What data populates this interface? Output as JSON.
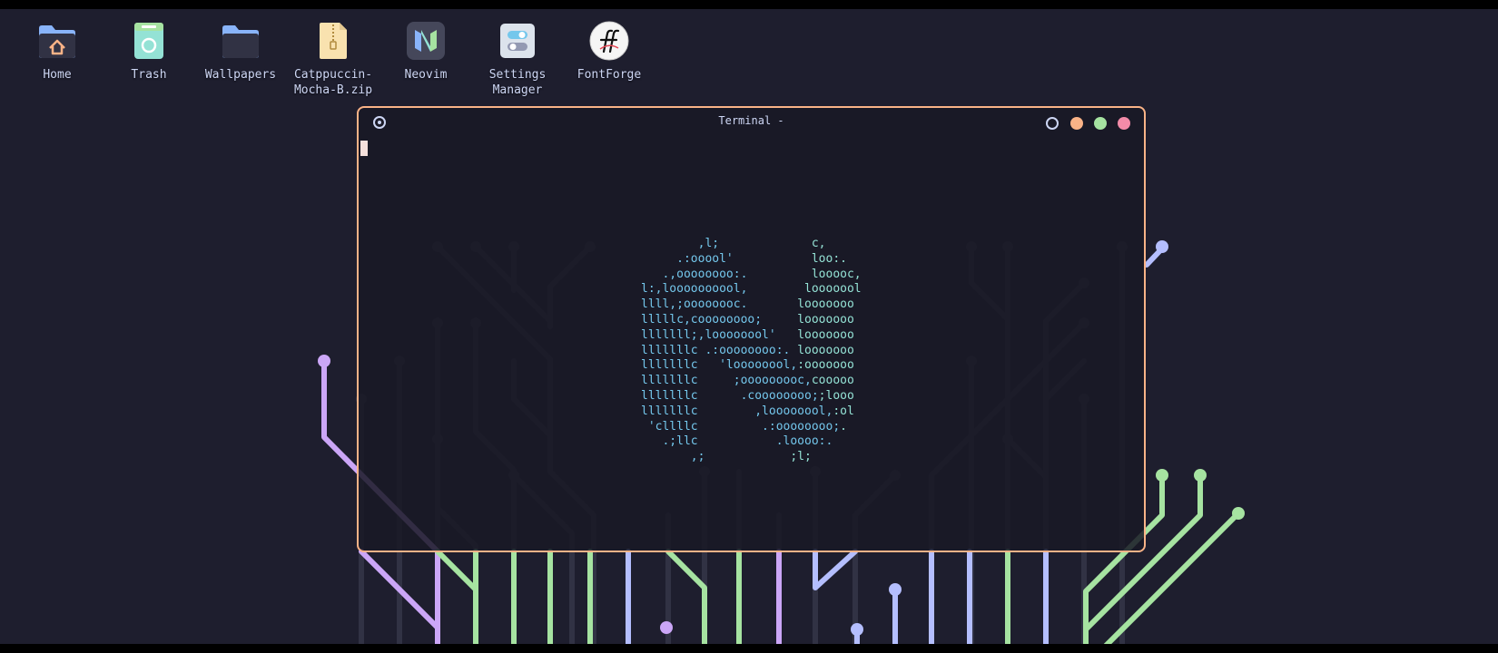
{
  "colors": {
    "background": "#1e1e2e",
    "terminal_border": "#fab387",
    "text": "#cdd6f4",
    "cursor": "#f5e0dc",
    "ascii_left": "#74c7ec",
    "ascii_right": "#94e2d5",
    "button_minimize": "#fab387",
    "button_maximize": "#a6e3a1",
    "button_close": "#f38ba8",
    "circuit_purple": "#cba6f7",
    "circuit_green": "#a6e3a1",
    "circuit_blue": "#b4befe",
    "circuit_dim": "#313244"
  },
  "desktop": {
    "icons": [
      {
        "label": "Home",
        "icon": "home-folder-icon"
      },
      {
        "label": "Trash",
        "icon": "trash-icon"
      },
      {
        "label": "Wallpapers",
        "icon": "folder-icon"
      },
      {
        "label": "Catppuccin-\nMocha-B.zip",
        "icon": "zip-archive-icon"
      },
      {
        "label": "Neovim",
        "icon": "neovim-icon"
      },
      {
        "label": "Settings\nManager",
        "icon": "settings-manager-icon"
      },
      {
        "label": "FontForge",
        "icon": "fontforge-icon"
      }
    ]
  },
  "terminal": {
    "title": "Terminal -",
    "ascii_logo": [
      {
        "left": "        ,l;",
        "right": "             c,"
      },
      {
        "left": "     .:ooool'",
        "right": "           loo:."
      },
      {
        "left": "   .,oooooooo:.",
        "right": "         looooc,"
      },
      {
        "left": "l:,loooooooool,",
        "right": "        looooool"
      },
      {
        "left": "llll,;oooooooc.",
        "right": "       looooooo"
      },
      {
        "left": "lllllc,coooooooo;",
        "right": "     looooooo"
      },
      {
        "left": "lllllll;,loooooool'",
        "right": "   looooooo"
      },
      {
        "left": "lllllllc .:oooooooo:.",
        "right": " looooooo"
      },
      {
        "left": "lllllllc   'loooooool,",
        "right": ":ooooooo"
      },
      {
        "left": "lllllllc     ;ooooooooc,",
        "right": "cooooo"
      },
      {
        "left": "lllllllc      .coooooooo;",
        "right": ";looo"
      },
      {
        "left": "lllllllc        ,loooooool,",
        "right": ":ol"
      },
      {
        "left": " 'cllllc         .:oooooooo;",
        "right": "."
      },
      {
        "left": "   .;llc           .loooo:.",
        "right": ""
      },
      {
        "left": "       ,;",
        "right": "            ;l;"
      }
    ]
  }
}
